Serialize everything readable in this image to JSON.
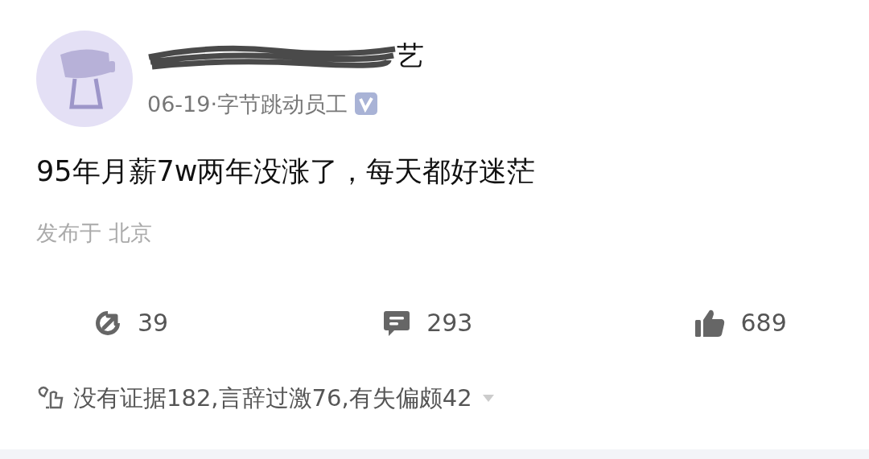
{
  "author": {
    "name_visible": "艺",
    "meta": "06-19·字节跳动员工",
    "verified": true
  },
  "post": {
    "text": "95年月薪7w两年没涨了，每天都好迷茫",
    "location": "发布于 北京"
  },
  "actions": [
    {
      "kind": "share",
      "count": "39"
    },
    {
      "kind": "comment",
      "count": "293"
    },
    {
      "kind": "like",
      "count": "689"
    }
  ],
  "feedback": {
    "text": "没有证据182,言辞过激76,有失偏颇42"
  }
}
